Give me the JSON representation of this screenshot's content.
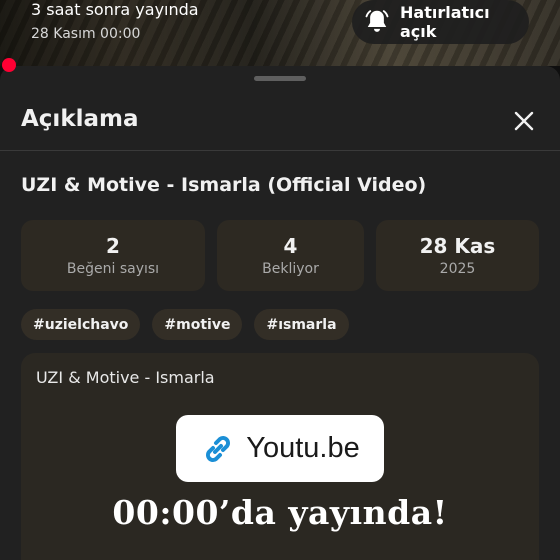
{
  "premiere": {
    "status": "3 saat sonra yayında",
    "date": "28 Kasım 00:00"
  },
  "reminder": {
    "label": "Hatırlatıcı açık",
    "icon": "bell-icon"
  },
  "sheet": {
    "title": "Açıklama",
    "close_icon": "close-icon"
  },
  "video": {
    "title": "UZI & Motive - Ismarla (Official Video)"
  },
  "stats": [
    {
      "value": "2",
      "label": "Beğeni sayısı"
    },
    {
      "value": "4",
      "label": "Bekliyor"
    },
    {
      "value": "28 Kas",
      "label": "2025"
    }
  ],
  "tags": [
    "#uzielchavo",
    "#motive",
    "#ısmarla"
  ],
  "description": {
    "text": "UZI & Motive - Ismarla",
    "link_label": "Youtu.be",
    "link_icon": "link-icon",
    "overlay": "00:00’da yayında!"
  },
  "colors": {
    "background": "#0f0f0f",
    "sheet": "#212121",
    "card": "#2d2922",
    "live_dot": "#ff0033",
    "link_icon": "#1b8fd6"
  }
}
